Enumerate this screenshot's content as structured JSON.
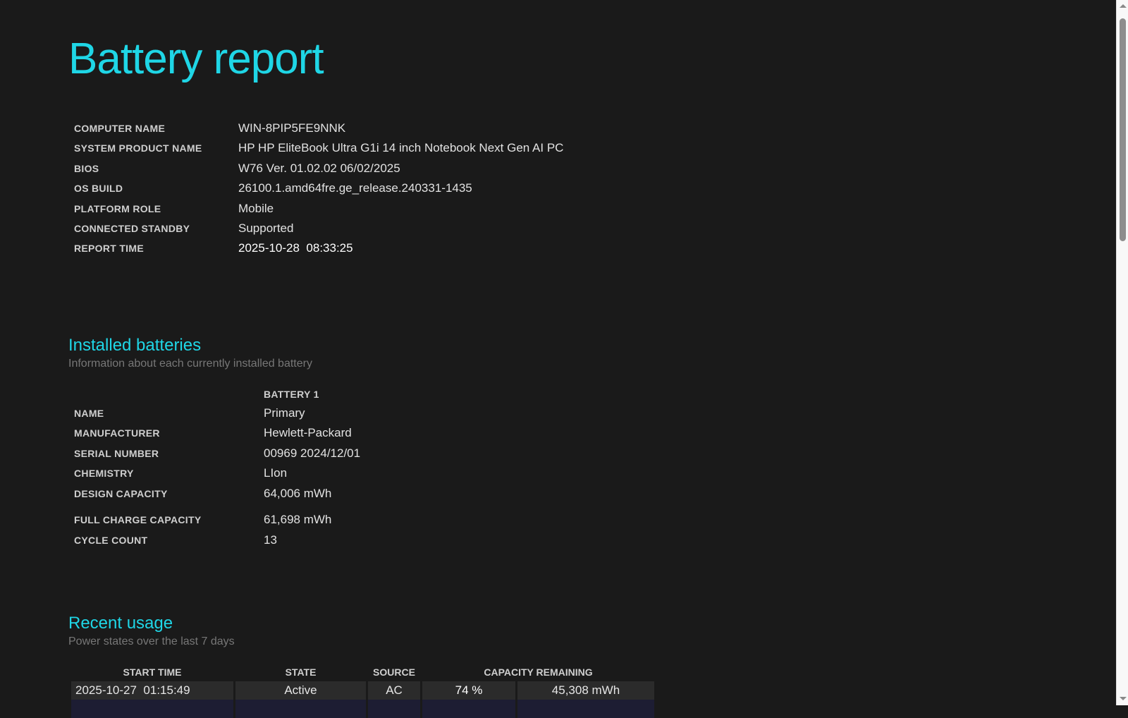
{
  "title": "Battery report",
  "system": [
    {
      "label": "COMPUTER NAME",
      "value": "WIN-8PIP5FE9NNK"
    },
    {
      "label": "SYSTEM PRODUCT NAME",
      "value": "HP HP EliteBook Ultra G1i 14 inch Notebook Next Gen AI PC"
    },
    {
      "label": "BIOS",
      "value": "W76 Ver. 01.02.02 06/02/2025"
    },
    {
      "label": "OS BUILD",
      "value": "26100.1.amd64fre.ge_release.240331-1435"
    },
    {
      "label": "PLATFORM ROLE",
      "value": "Mobile"
    },
    {
      "label": "CONNECTED STANDBY",
      "value": "Supported"
    },
    {
      "label": "REPORT TIME",
      "value": "2025-10-28  08:33:25"
    }
  ],
  "installed": {
    "heading": "Installed batteries",
    "subtitle": "Information about each currently installed battery",
    "column": "BATTERY 1",
    "rows": [
      {
        "label": "NAME",
        "value": "Primary"
      },
      {
        "label": "MANUFACTURER",
        "value": "Hewlett-Packard"
      },
      {
        "label": "SERIAL NUMBER",
        "value": "00969 2024/12/01"
      },
      {
        "label": "CHEMISTRY",
        "value": "LIon"
      },
      {
        "label": "DESIGN CAPACITY",
        "value": "64,006 mWh"
      },
      {
        "label": "FULL CHARGE CAPACITY",
        "value": "61,698 mWh"
      },
      {
        "label": "CYCLE COUNT",
        "value": "13"
      }
    ]
  },
  "recent": {
    "heading": "Recent usage",
    "subtitle": "Power states over the last 7 days",
    "columns": [
      "START TIME",
      "STATE",
      "SOURCE",
      "CAPACITY REMAINING"
    ],
    "rows": [
      {
        "start": "2025-10-27  01:15:49",
        "state": "Active",
        "source": "AC",
        "percent": "74 %",
        "mwh": "45,308 mWh"
      }
    ]
  }
}
